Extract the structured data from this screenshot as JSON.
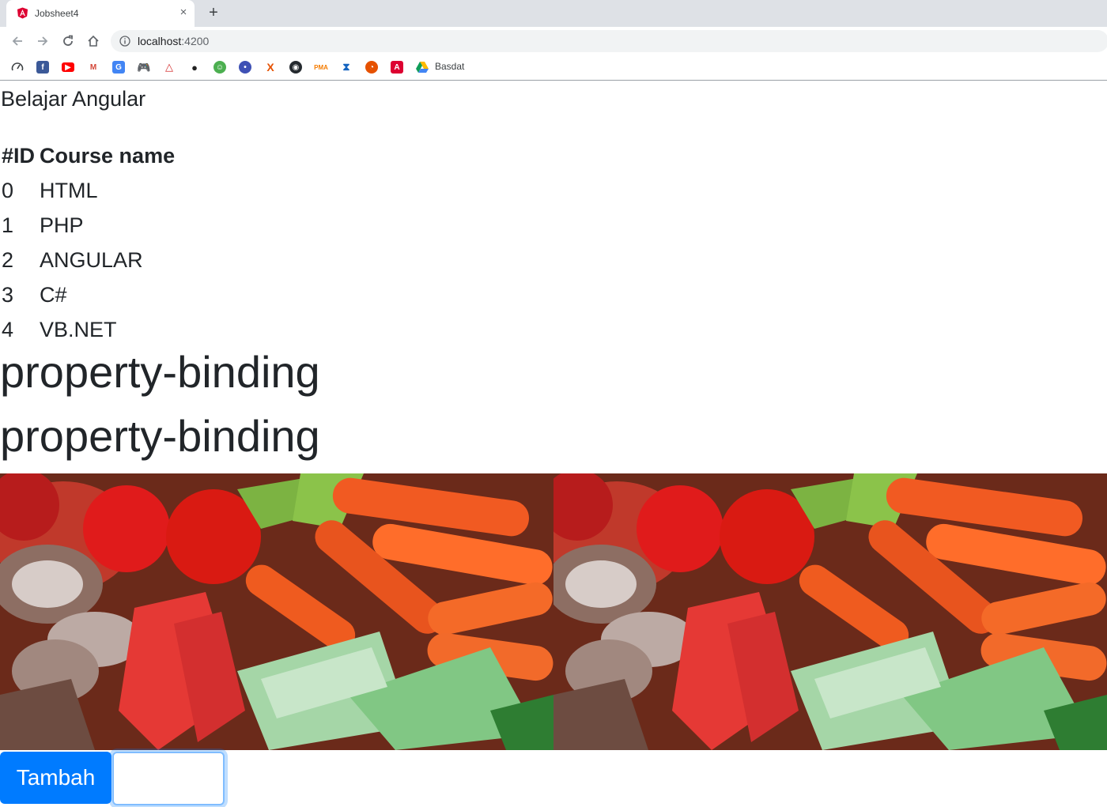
{
  "browser": {
    "tab_title": "Jobsheet4",
    "new_tab_symbol": "+",
    "close_symbol": "×",
    "url_host": "localhost",
    "url_port": ":4200",
    "bookmark_folder_label": "Basdat"
  },
  "page": {
    "title": "Belajar Angular",
    "table": {
      "headers": [
        "#ID",
        "Course name"
      ],
      "rows": [
        {
          "id": "0",
          "name": "HTML"
        },
        {
          "id": "1",
          "name": "PHP"
        },
        {
          "id": "2",
          "name": "ANGULAR"
        },
        {
          "id": "3",
          "name": "C#"
        },
        {
          "id": "4",
          "name": "VB.NET"
        }
      ]
    },
    "heading_1": "property-binding",
    "heading_2": "property-binding",
    "button_label": "Tambah",
    "input_value": ""
  },
  "colors": {
    "primary": "#007bff",
    "tabbar": "#dee1e6",
    "angular_red": "#dd0031"
  }
}
